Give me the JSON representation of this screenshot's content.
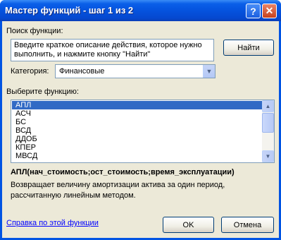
{
  "window": {
    "title": "Мастер функций - шаг 1 из 2",
    "help_glyph": "?",
    "close_glyph": "✕"
  },
  "search": {
    "label": "Поиск функции:",
    "description": "Введите краткое описание действия, которое нужно выполнить, и нажмите кнопку \"Найти\"",
    "find_button": "Найти"
  },
  "category": {
    "label": "Категория:",
    "selected": "Финансовые",
    "arrow_icon": "chevron-down-icon"
  },
  "functions": {
    "label": "Выберите функцию:",
    "items": [
      "АПЛ",
      "АСЧ",
      "БС",
      "ВСД",
      "ДДОБ",
      "КПЕР",
      "МВСД"
    ],
    "selected_index": 0
  },
  "details": {
    "syntax": "АПЛ(нач_стоимость;ост_стоимость;время_эксплуатации)",
    "description": "Возвращает величину амортизации актива за один период, рассчитанную линейным методом."
  },
  "footer": {
    "help_link": "Справка по этой функции",
    "ok_button": "OK",
    "cancel_button": "Отмена"
  },
  "colors": {
    "titlebar": "#0553de",
    "dialog_bg": "#ece9d8",
    "selection": "#316ac5",
    "link": "#0000ff"
  }
}
